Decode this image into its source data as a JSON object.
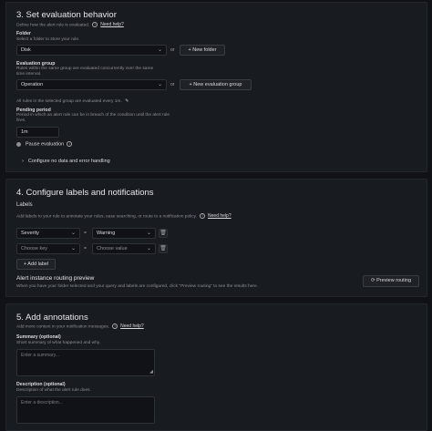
{
  "section3": {
    "title": "3. Set evaluation behavior",
    "description": "Define how the alert rule is evaluated.",
    "need_help": "Need help?",
    "folder": {
      "label": "Folder",
      "description": "Select a folder to store your rule.",
      "value": "Disk",
      "or": "or",
      "new_folder": "New folder"
    },
    "group": {
      "label": "Evaluation group",
      "description_line1": "Rules within the same group are evaluated concurrently over the same",
      "description_line2": "time interval.",
      "value": "Operation",
      "or": "or",
      "new_group": "New evaluation group"
    },
    "interval_note": "All rules in the selected group are evaluated every 1m.",
    "pending": {
      "label": "Pending period",
      "description_line1": "Period in which an alert rule can be in breach of the condition until the alert rule",
      "description_line2": "fires.",
      "value": "1m"
    },
    "pause_label": "Pause evaluation",
    "configure_no_data": "Configure no data and error handling"
  },
  "section4": {
    "title": "4. Configure labels and notifications",
    "labels_heading": "Labels",
    "labels_description": "Add labels to your rule to annotate your rules, ease searching, or route to a notification policy.",
    "need_help": "Need help?",
    "rows": [
      {
        "key": "Severity",
        "op": "=",
        "value": "Warning"
      },
      {
        "key": "Choose key",
        "op": "=",
        "value": "Choose value"
      }
    ],
    "add_label": "Add label",
    "routing_title": "Alert instance routing preview",
    "routing_description": "When you have your folder selected and your query and labels are configured, click \"Preview routing\" to see the results here.",
    "preview_routing": "Preview routing"
  },
  "section5": {
    "title": "5. Add annotations",
    "description": "Add more context in your notification messages.",
    "need_help": "Need help?",
    "summary": {
      "label": "Summary (optional)",
      "description": "Short summary of what happened and why.",
      "placeholder": "Enter a summary..."
    },
    "desc": {
      "label": "Description (optional)",
      "description": "Description of what the alert rule does.",
      "placeholder": "Enter a description..."
    }
  }
}
